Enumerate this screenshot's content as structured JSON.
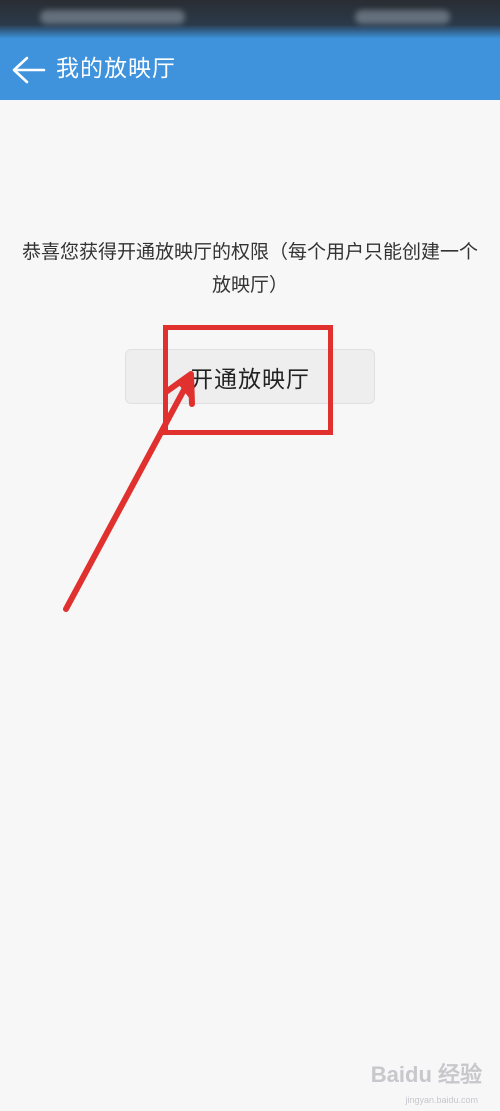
{
  "header": {
    "title": "我的放映厅",
    "back_icon": "back-arrow-icon"
  },
  "main": {
    "message": "恭喜您获得开通放映厅的权限（每个用户只能创建一个放映厅）",
    "open_button_label": "开通放映厅"
  },
  "annotation": {
    "highlight_color": "#e0312e",
    "arrow_color": "#e0312e"
  },
  "colors": {
    "app_bar": "#3f93dd",
    "background": "#f7f7f8",
    "button_bg": "#eeeeef"
  },
  "watermark": {
    "brand": "Baidu 经验",
    "sub": "jingyan.baidu.com"
  }
}
